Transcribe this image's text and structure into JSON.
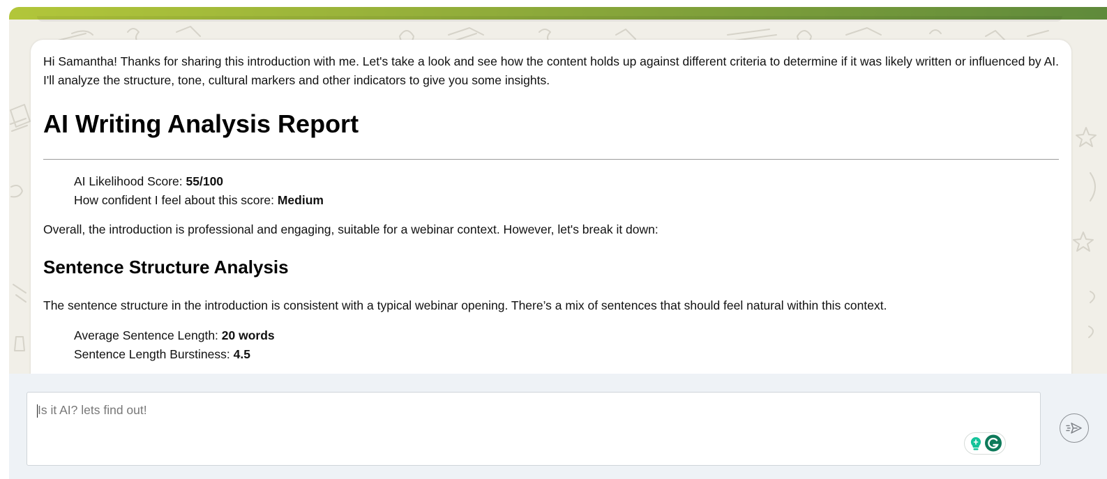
{
  "message": {
    "intro": "Hi Samantha! Thanks for sharing this introduction with me. Let's take a look and see how the content holds up against different criteria to determine if it was likely written or influenced by AI. I'll analyze the structure, tone, cultural markers and other indicators to give you some insights.",
    "report_title": "AI Writing Analysis Report",
    "score_label": "AI Likelihood Score: ",
    "score_value": "55/100",
    "confidence_label": "How confident I feel about this score: ",
    "confidence_value": "Medium",
    "overall": "Overall, the introduction is professional and engaging, suitable for a webinar context. However, let's break it down:",
    "section_title": "Sentence Structure Analysis",
    "structure_text": "The sentence structure in the introduction is consistent with a typical webinar opening. There’s a mix of sentences that should feel natural within this context.",
    "avg_length_label": "Average Sentence Length: ",
    "avg_length_value": "20 words",
    "burstiness_label": "Sentence Length Burstiness: ",
    "burstiness_value": "4.5"
  },
  "composer": {
    "placeholder": "Is it AI? lets find out!"
  },
  "icons": {
    "grammarly_ideas": "lightbulb-icon",
    "grammarly": "grammarly-g-icon",
    "send": "send-icon"
  },
  "colors": {
    "header_gradient_start": "#b2c63a",
    "header_gradient_end": "#5f8a3b",
    "grammarly_teal": "#15c39a",
    "grammarly_green": "#0e7a5a"
  }
}
